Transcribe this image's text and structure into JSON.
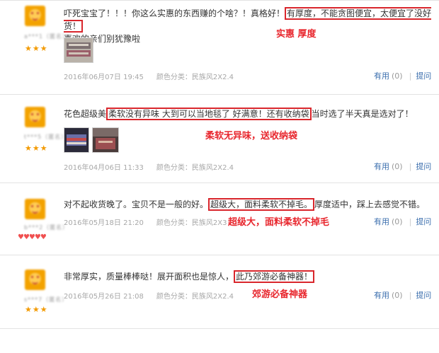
{
  "reviews": [
    {
      "user": "a***1（匿名）",
      "stars": "★★★",
      "before": "吓死宝宝了！！！你这么实惠的东西赚的个啥？！真格好！",
      "highlight": "有厚度，不能贪图便宜，太便宜了没好货！",
      "after": "喜欢的亲们别犹豫啦",
      "note": "实惠 厚度",
      "date": "2016年06月07日 19:45",
      "category_label": "颜色分类：",
      "category_value": "民族风2X2.4",
      "useful_label": "有用",
      "useful_count": "(0)",
      "ask_label": "提问"
    },
    {
      "user": "t***5（匿名）",
      "stars": "★★★",
      "before": "花色超级美",
      "highlight": "柔软没有异味 大到可以当地毯了 好满意！还有收纳袋",
      "after": "当时选了半天真是选对了！",
      "note": "柔软无异味，送收纳袋",
      "date": "2016年04月06日 11:33",
      "category_label": "颜色分类：",
      "category_value": "民族风2X2.4",
      "useful_label": "有用",
      "useful_count": "(0)",
      "ask_label": "提问"
    },
    {
      "user": "b***2（匿名）",
      "stars": "♥♥♥♥♥",
      "before": "对不起收货晚了。宝贝不是一般的好。",
      "highlight": "超级大，面料柔软不掉毛。",
      "after": "厚度适中，踩上去感觉不错。",
      "note": "超级大，面料柔软不掉毛",
      "date": "2016年05月18日 21:20",
      "category_label": "颜色分类：",
      "category_value": "民族风2X3",
      "useful_label": "有用",
      "useful_count": "(0)",
      "ask_label": "提问"
    },
    {
      "user": "s***7（匿名）",
      "stars": "★★★",
      "before": "非常厚实，质量棒棒哒！展开面积也是惊人，",
      "highlight": "此乃郊游必备神器！",
      "after": "",
      "note": "郊游必备神器",
      "date": "2016年05月26日 21:08",
      "category_label": "颜色分类：",
      "category_value": "民族风2X2.4",
      "useful_label": "有用",
      "useful_count": "(0)",
      "ask_label": "提问"
    }
  ],
  "colors": {
    "highlight_box": "#d9262c",
    "note_text": "#e8262d",
    "link": "#3c6fae",
    "star": "#f39a00"
  }
}
